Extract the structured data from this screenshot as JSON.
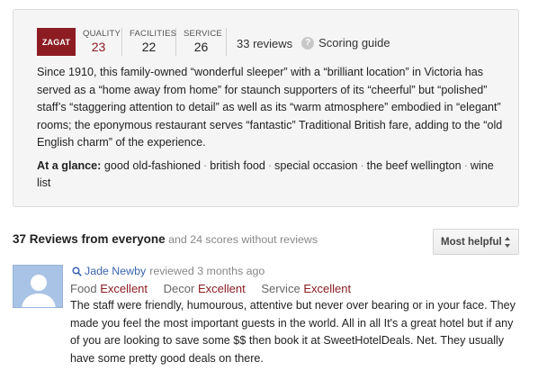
{
  "zagat": {
    "logo_text": "ZAGAT",
    "brand_color": "#8c1c22",
    "scores": [
      {
        "label": "QUALITY",
        "value": "23"
      },
      {
        "label": "FACILITIES",
        "value": "22"
      },
      {
        "label": "SERVICE",
        "value": "26"
      }
    ],
    "review_count": "33 reviews",
    "scoring_guide_label": "Scoring guide",
    "scoring_guide_icon": "?",
    "description": "Since 1910, this family-owned “wonderful sleeper” with a “brilliant location” in Victoria has served as a “home away from home” for staunch supporters of its “cheerful” but “polished” staff’s “staggering attention to detail” as well as its “warm atmosphere” embodied in “elegant” rooms; the eponymous restaurant serves “fantastic” Traditional British fare, adding to the “old English charm” of the experience.",
    "glance_label": "At a glance:",
    "glance_separator": "·",
    "glance_items": [
      "good old-fashioned",
      "british food",
      "special occasion",
      "the beef wellington",
      "wine list"
    ]
  },
  "reviews": {
    "title": "37 Reviews from everyone",
    "subtitle": "and 24 scores without reviews",
    "sort_label": "Most helpful",
    "items": [
      {
        "reviewer": "Jade Newby",
        "meta": "reviewed 3 months ago",
        "ratings": [
          {
            "category": "Food",
            "value": "Excellent"
          },
          {
            "category": "Decor",
            "value": "Excellent"
          },
          {
            "category": "Service",
            "value": "Excellent"
          }
        ],
        "text": "The staff were friendly, humourous, attentive but never over bearing or in your face. They made you feel the most important guests in the world. All in all It's a great hotel but if any of you are looking to save some $$ then book it at SweetHotelDeals. Net. They usually have some pretty good deals on there."
      }
    ]
  }
}
